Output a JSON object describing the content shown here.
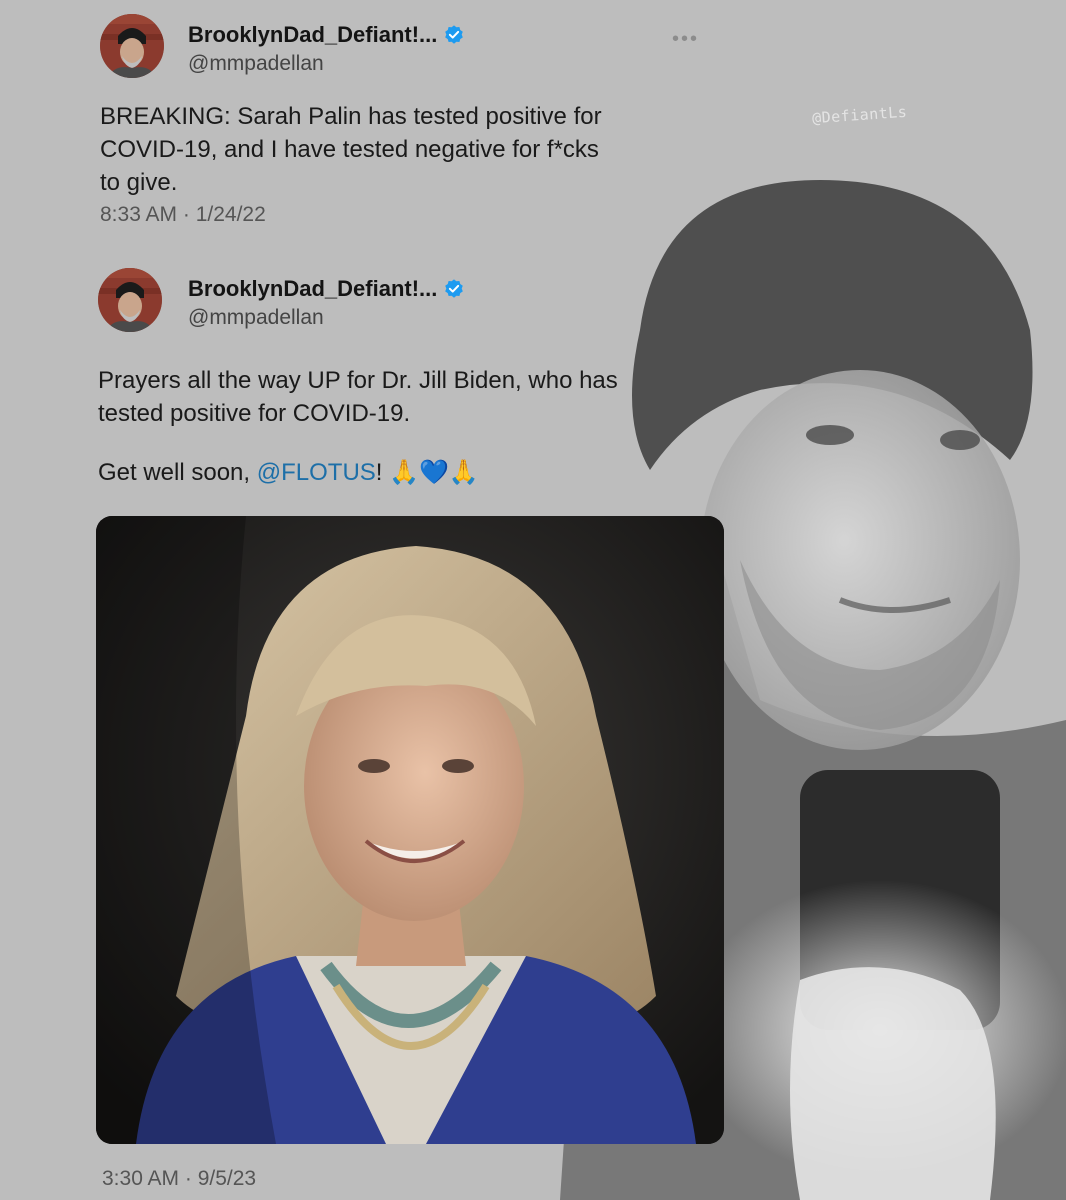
{
  "watermark": "@DefiantLs",
  "tweets": [
    {
      "display_name": "BrooklynDad_Defiant!...",
      "handle": "@mmpadellan",
      "more": "•••",
      "text_lines": [
        "BREAKING: Sarah Palin has tested positive for",
        "COVID-19, and I have tested negative for f*cks",
        "to give."
      ],
      "timestamp": "8:33 AM · 1/24/22"
    },
    {
      "display_name": "BrooklynDad_Defiant!...",
      "handle": "@mmpadellan",
      "text_lines": [
        "Prayers all the way UP for Dr. Jill Biden, who has",
        "tested positive for COVID-19."
      ],
      "text2_prefix": "Get well soon, ",
      "mention": "@FLOTUS",
      "text2_suffix": "! 🙏💙🙏",
      "timestamp": "3:30 AM · 9/5/23"
    }
  ],
  "colors": {
    "verified": "#1d9bf0",
    "mention": "#1d6fa8",
    "background": "#bdbdbd"
  }
}
